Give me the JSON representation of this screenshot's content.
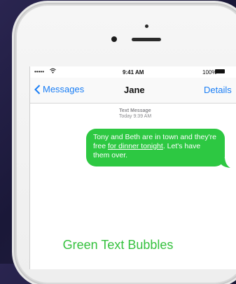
{
  "status_bar": {
    "signal": "•••••",
    "time": "9:41 AM",
    "battery": "100%"
  },
  "nav": {
    "back_label": "Messages",
    "title": "Jane",
    "details_label": "Details"
  },
  "conversation": {
    "meta_kind": "Text Message",
    "meta_time": "Today 9:39 AM",
    "message": {
      "before_link": "Tony and Beth are in town and they're free ",
      "link": "for dinner tonight",
      "after_link": ". Let's have them over."
    }
  },
  "caption": "Green Text Bubbles",
  "colors": {
    "bubble": "#2dc842",
    "accent": "#1a7ef5",
    "caption": "#35c13e"
  }
}
